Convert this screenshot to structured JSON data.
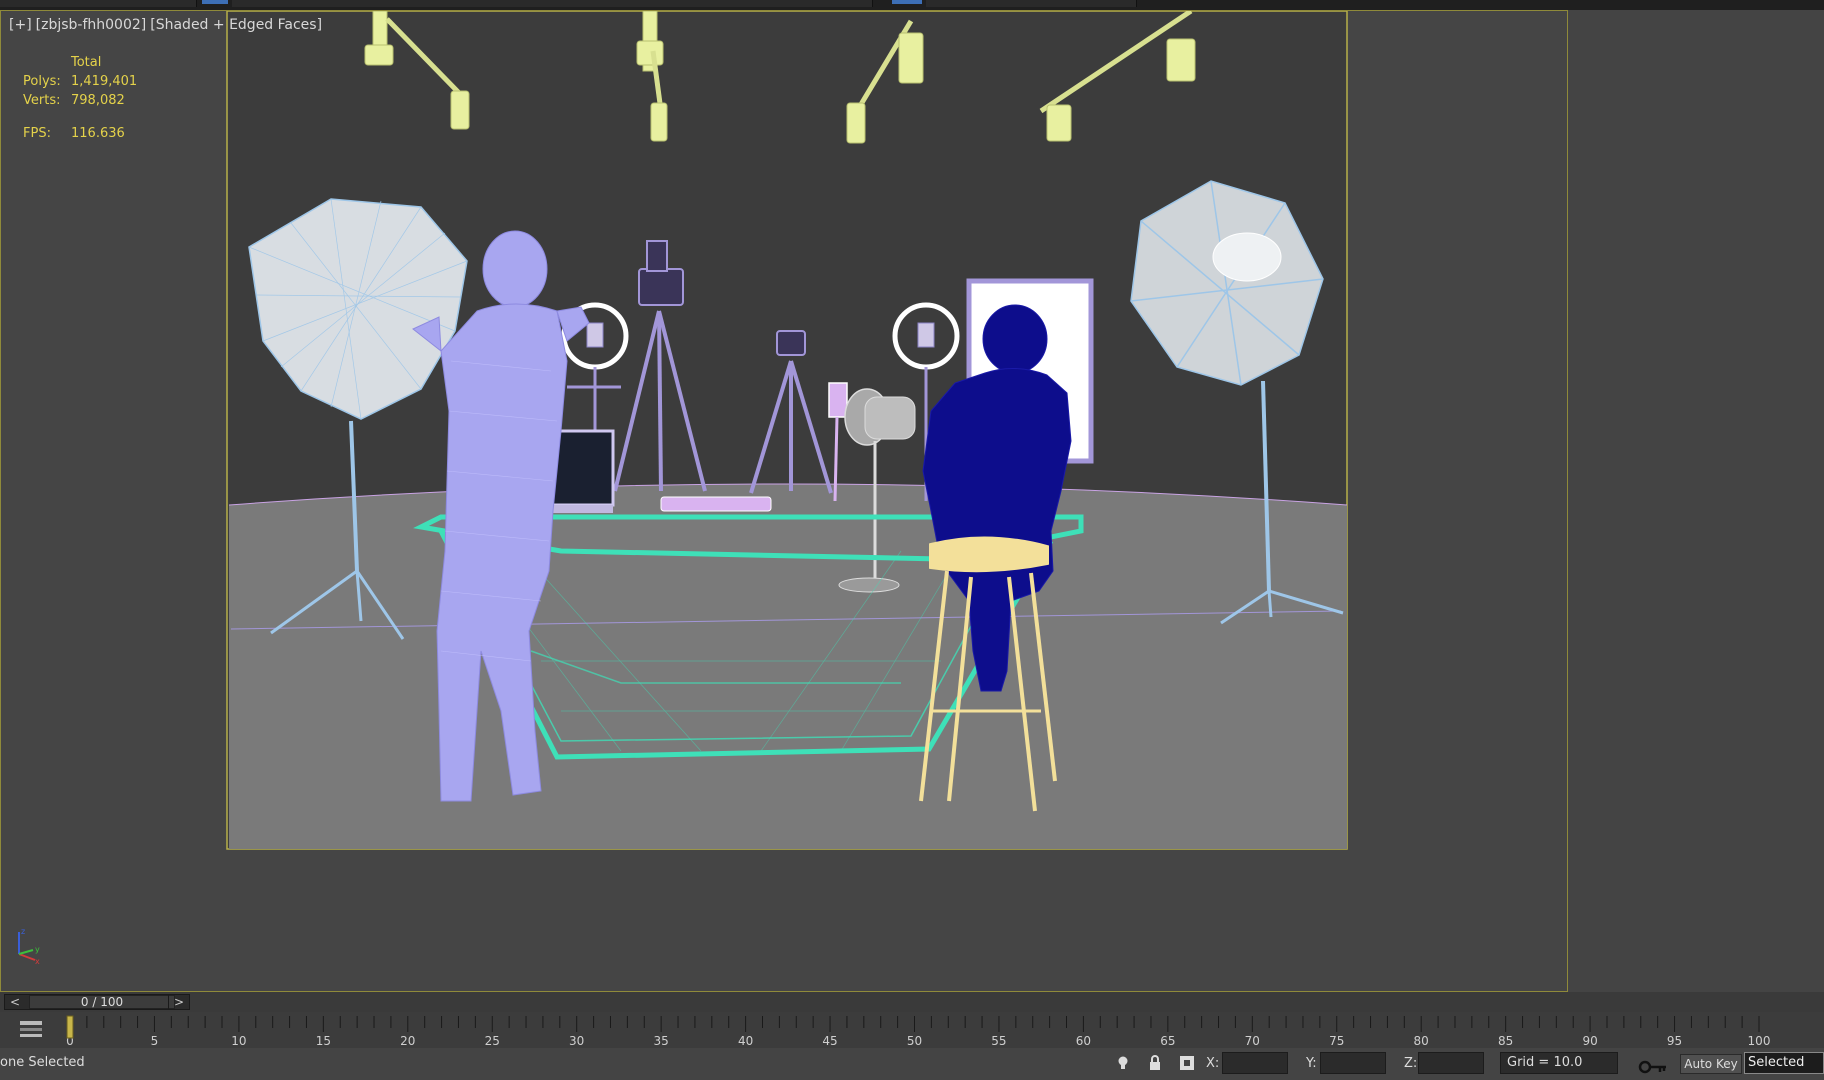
{
  "viewport": {
    "label_menu": "[+]",
    "label_view": "[zbjsb-fhh0002]",
    "label_mode": "[Shaded + Edged Faces]"
  },
  "stats": {
    "header": "Total",
    "polys_label": "Polys:",
    "polys_value": "1,419,401",
    "verts_label": "Verts:",
    "verts_value": "798,082",
    "fps_label": "FPS:",
    "fps_value": "116.636"
  },
  "axis_gizmo": {
    "x": "x",
    "y": "y",
    "z": "z"
  },
  "time_slider": {
    "label": "0 / 100",
    "prev": "<",
    "next": ">"
  },
  "timeline": {
    "ticks": [
      "0",
      "5",
      "10",
      "15",
      "20",
      "25",
      "30",
      "35",
      "40",
      "45",
      "50",
      "55",
      "60",
      "65",
      "70",
      "75",
      "80",
      "85",
      "90",
      "95",
      "100"
    ],
    "current_frame": 0,
    "total_frames": 100
  },
  "status": {
    "selection_text": "one Selected",
    "x_label": "X:",
    "y_label": "Y:",
    "z_label": "Z:",
    "grid_text": "Grid = 10.0",
    "autokey_label": "Auto Key",
    "selected_option": "Selected"
  },
  "icons": [
    "key-filter-icon",
    "lightbulb-icon",
    "lock-icon",
    "absolute-mode-icon",
    "set-key-icon"
  ],
  "colors": {
    "viewport_border": "#8f8a3a",
    "stats_text": "#e4d24a",
    "female_figure": "#a8a6f0",
    "male_figure": "#0d0d8c",
    "table": "#3ee0b8",
    "stool": "#f3e09a",
    "lights": "#e8f0a0",
    "umbrella": "#9ec6e8"
  }
}
